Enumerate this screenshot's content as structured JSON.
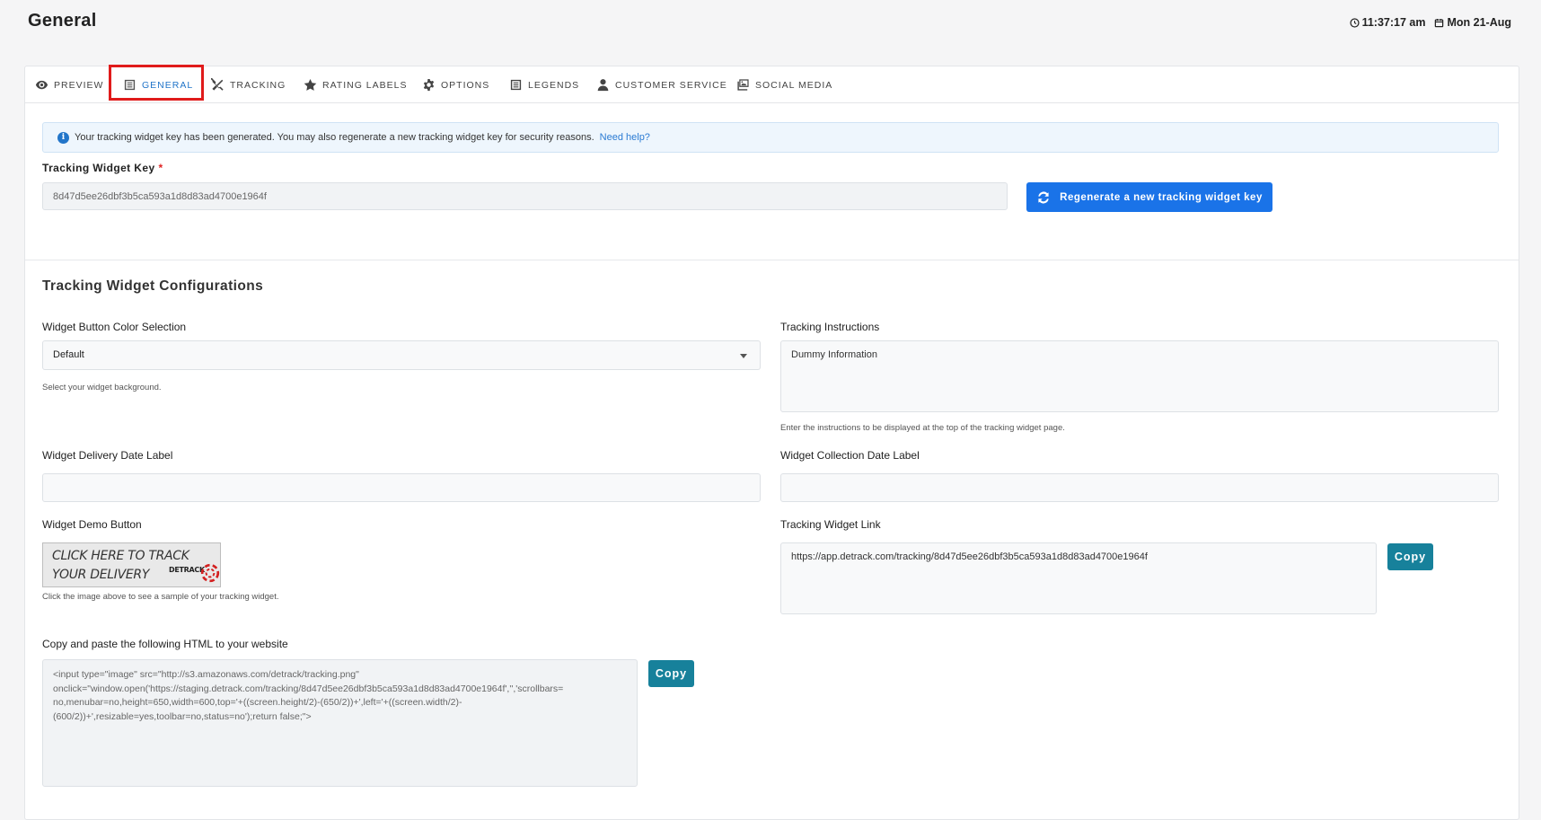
{
  "header": {
    "title": "General",
    "time": "11:37:17 am",
    "date": "Mon 21-Aug"
  },
  "tabs": [
    {
      "label": "PREVIEW",
      "icon": "eye-icon"
    },
    {
      "label": "GENERAL",
      "icon": "list-icon",
      "active": true
    },
    {
      "label": "TRACKING",
      "icon": "tools-icon"
    },
    {
      "label": "RATING LABELS",
      "icon": "star-icon"
    },
    {
      "label": "OPTIONS",
      "icon": "gear-icon"
    },
    {
      "label": "LEGENDS",
      "icon": "list-icon"
    },
    {
      "label": "CUSTOMER SERVICE",
      "icon": "user-icon"
    },
    {
      "label": "SOCIAL MEDIA",
      "icon": "images-icon"
    }
  ],
  "alert": {
    "text": "Your tracking widget key has been generated. You may also regenerate a new tracking widget key for security reasons.",
    "link": "Need help?"
  },
  "widget_key": {
    "label": "Tracking Widget Key",
    "required_mark": "*",
    "value": "8d47d5ee26dbf3b5ca593a1d8d83ad4700e1964f",
    "regenerate_label": "Regenerate a new tracking widget key"
  },
  "configurations": {
    "title": "Tracking Widget Configurations",
    "button_color": {
      "label": "Widget Button Color Selection",
      "value": "Default",
      "help": "Select your widget background."
    },
    "instructions": {
      "label": "Tracking Instructions",
      "value": "Dummy Information",
      "help": "Enter the instructions to be displayed at the top of the tracking widget page."
    },
    "delivery_date": {
      "label": "Widget Delivery Date Label",
      "value": ""
    },
    "collection_date": {
      "label": "Widget Collection Date Label",
      "value": ""
    },
    "demo_button": {
      "label": "Widget Demo Button",
      "line1": "CLICK HERE TO TRACK",
      "line2": "YOUR DELIVERY",
      "brand": "DETRACK",
      "help": "Click the image above to see a sample of your tracking widget."
    },
    "widget_link": {
      "label": "Tracking Widget Link",
      "value": "https://app.detrack.com/tracking/8d47d5ee26dbf3b5ca593a1d8d83ad4700e1964f",
      "copy_label": "Copy"
    },
    "html_snippet": {
      "label": "Copy and paste the following HTML to your website",
      "value": "<input type=\"image\" src=\"http://s3.amazonaws.com/detrack/tracking.png\"\nonclick=\"window.open('https://staging.detrack.com/tracking/8d47d5ee26dbf3b5ca593a1d8d83ad4700e1964f','','scrollbars=\nno,menubar=no,height=650,width=600,top='+((screen.height/2)-(650/2))+',left='+((screen.width/2)-\n(600/2))+',resizable=yes,toolbar=no,status=no');return false;\">",
      "copy_label": "Copy"
    }
  }
}
